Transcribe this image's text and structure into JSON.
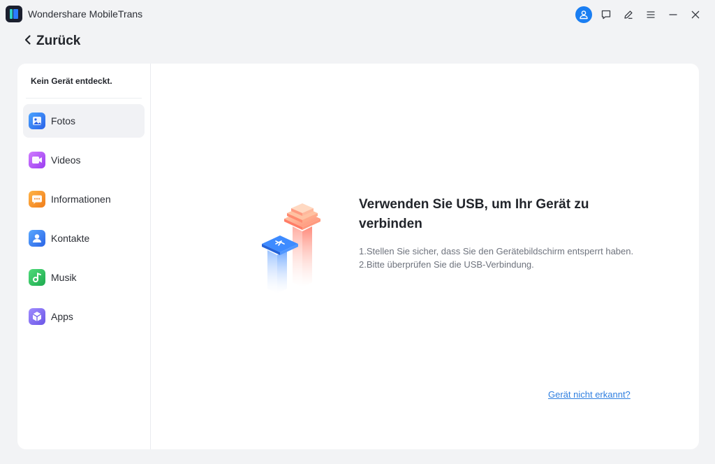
{
  "window": {
    "title": "Wondershare MobileTrans"
  },
  "header": {
    "back_label": "Zurück"
  },
  "sidebar": {
    "status": "Kein Gerät entdeckt.",
    "items": [
      {
        "label": "Fotos",
        "icon": "photos-icon",
        "active": true
      },
      {
        "label": "Videos",
        "icon": "videos-icon"
      },
      {
        "label": "Informationen",
        "icon": "messages-icon"
      },
      {
        "label": "Kontakte",
        "icon": "contacts-icon"
      },
      {
        "label": "Musik",
        "icon": "music-icon"
      },
      {
        "label": "Apps",
        "icon": "apps-icon"
      }
    ]
  },
  "main": {
    "title": "Verwenden Sie USB, um Ihr Gerät zu verbinden",
    "instructions": [
      "1.Stellen Sie sicher, dass Sie den Gerätebildschirm entsperrt haben.",
      "2.Bitte überprüfen Sie die USB-Verbindung."
    ],
    "help_link": "Gerät nicht erkannt?"
  },
  "colors": {
    "accent": "#1a7ef2",
    "link": "#2f7fe0",
    "background": "#f2f3f5",
    "panel": "#ffffff"
  }
}
